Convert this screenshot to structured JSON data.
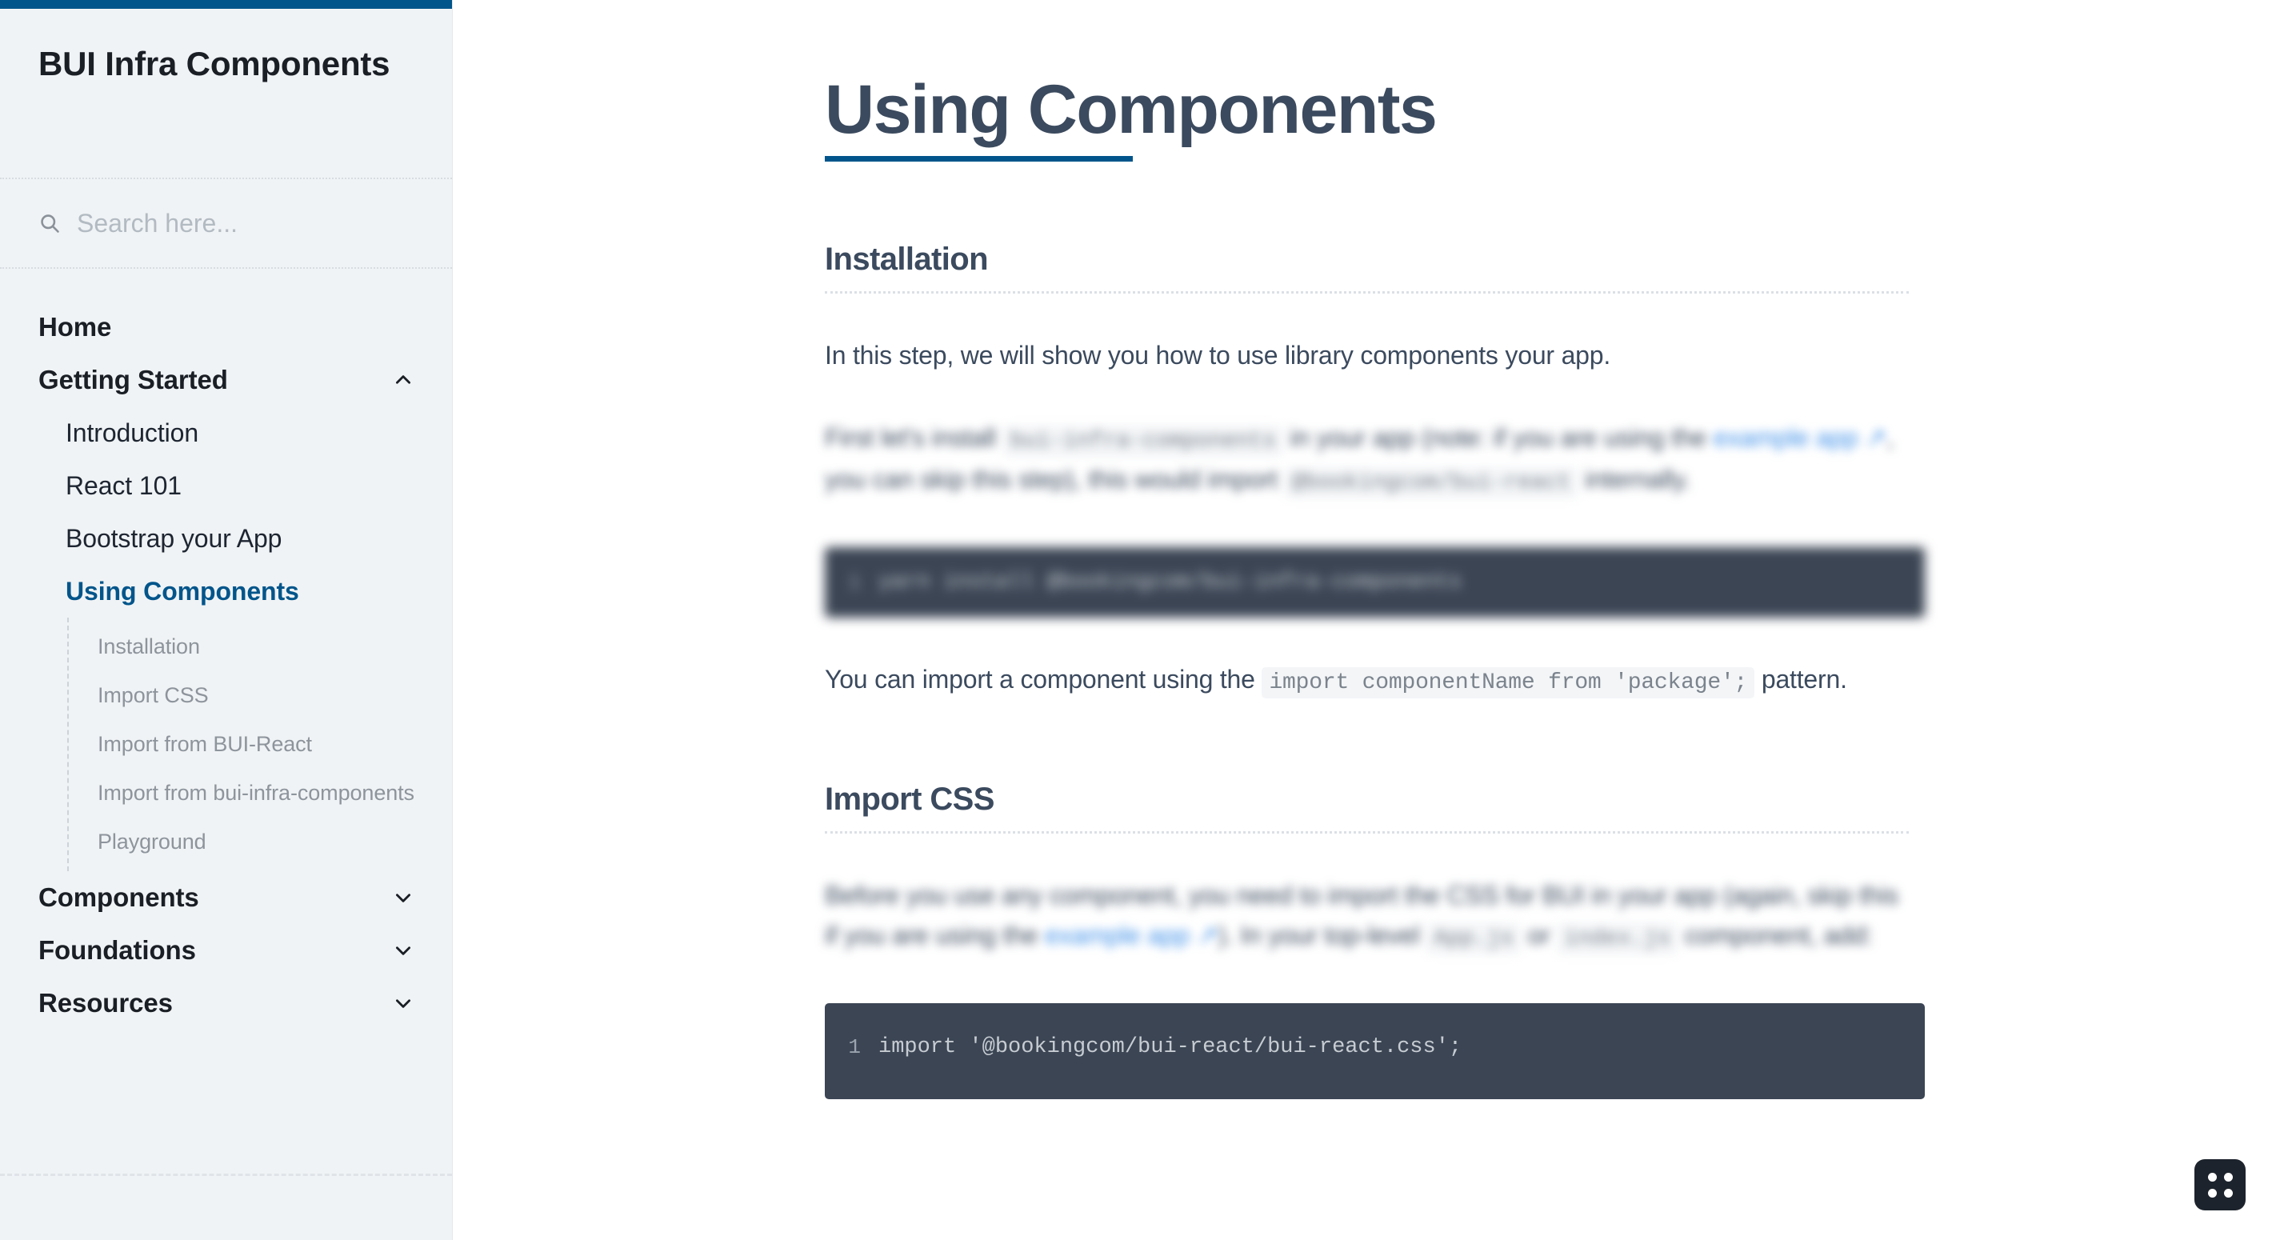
{
  "brand": {
    "title": "BUI Infra Components"
  },
  "search": {
    "placeholder": "Search here...",
    "value": ""
  },
  "sidebar": {
    "nav": [
      {
        "label": "Home",
        "type": "top",
        "chevron": ""
      },
      {
        "label": "Getting Started",
        "type": "top",
        "chevron": "chevron-up"
      }
    ],
    "getting_started_items": [
      {
        "label": "Introduction",
        "active": false
      },
      {
        "label": "React 101",
        "active": false
      },
      {
        "label": "Bootstrap your App",
        "active": false
      },
      {
        "label": "Using Components",
        "active": true
      }
    ],
    "using_components_sub": [
      {
        "label": "Installation"
      },
      {
        "label": "Import CSS"
      },
      {
        "label": "Import from BUI-React"
      },
      {
        "label": "Import from bui-infra-components"
      },
      {
        "label": "Playground"
      }
    ],
    "nav_bottom": [
      {
        "label": "Components",
        "chevron": "chevron-down"
      },
      {
        "label": "Foundations",
        "chevron": "chevron-down"
      },
      {
        "label": "Resources",
        "chevron": "chevron-down"
      }
    ]
  },
  "main": {
    "page_title": "Using Components",
    "sections": [
      {
        "heading": "Installation",
        "intro": "In this step, we will show you how to use library components your app.",
        "blurred_paragraph": {
          "part1": "First let's install ",
          "code1": "bui-infra-components",
          "part2": " in your app (note: if you are using the ",
          "link1": "example app ↗",
          "part3": ", you can skip this step), this would import ",
          "code2": "@bookingcom/bui-react",
          "part4": " internally."
        },
        "code": {
          "line_number": "1",
          "text": "yarn install @bookingcom/bui-infra-components"
        },
        "after_code": {
          "part1": "You can import a component using the ",
          "code": "import componentName from 'package';",
          "part2": " pattern."
        }
      },
      {
        "heading": "Import CSS",
        "blurred_paragraph": {
          "part1": "Before you use any component, you need to import the CSS for BUI in your app (again, skip this if you are using the ",
          "link1": "example app ↗",
          "part2": "). In your top-level ",
          "code1": "App.js",
          "part3": " or ",
          "code2": "index.js",
          "part4": " component, add:"
        },
        "code": {
          "line_number": "1",
          "text": "import '@bookingcom/bui-react/bui-react.css';"
        }
      }
    ]
  },
  "fab": {
    "label": "grid-menu"
  },
  "colors": {
    "accent": "#00558b",
    "sidebar_bg": "#f0f3f5",
    "heading": "#3b4a5e",
    "code_bg": "#3b4554",
    "link": "#3d8ee8",
    "fab_bg": "#1d232c"
  }
}
